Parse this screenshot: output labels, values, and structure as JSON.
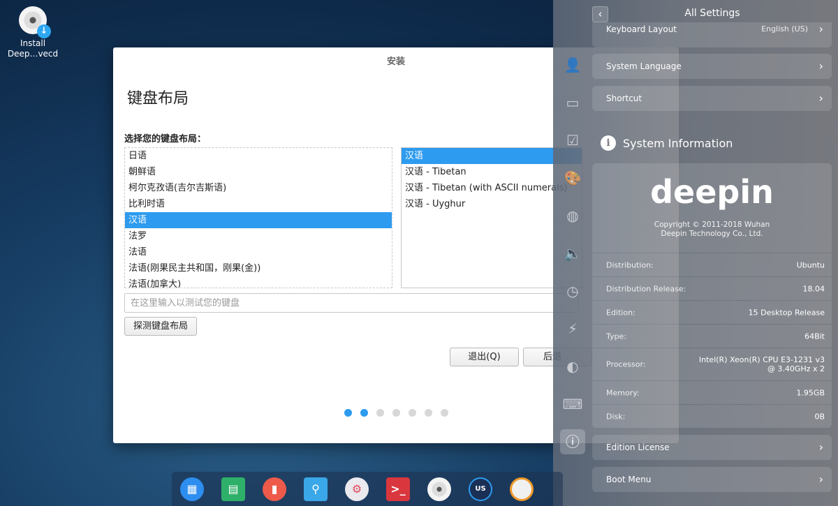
{
  "desktop": {
    "icon_label_line1": "Install",
    "icon_label_line2": "Deep…vecd"
  },
  "installer": {
    "window_title": "安装",
    "heading": "键盘布局",
    "prompt": "选择您的键盘布局：",
    "layouts": [
      "日语",
      "朝鲜语",
      "柯尔克孜语(吉尔吉斯语)",
      "比利时语",
      "汉语",
      "法罗",
      "法语",
      "法语(刚果民主共和国，刚果(金))",
      "法语(加拿大)"
    ],
    "selected_layout": "汉语",
    "variants": [
      "汉语",
      "汉语 - Tibetan",
      "汉语 - Tibetan (with ASCII numerals)",
      "汉语 - Uyghur"
    ],
    "selected_variant": "汉语",
    "test_placeholder": "在这里输入以测试您的键盘",
    "detect_button": "探测键盘布局",
    "quit_button": "退出(Q)",
    "next_button": "后退",
    "progress_steps": 7,
    "progress_completed": 2
  },
  "control_center": {
    "title": "All Settings",
    "rows": {
      "keyboard_layout": {
        "label": "Keyboard Layout",
        "value": "English (US)"
      },
      "system_language": {
        "label": "System Language"
      },
      "shortcut": {
        "label": "Shortcut"
      },
      "edition_license": {
        "label": "Edition License"
      },
      "boot_menu": {
        "label": "Boot Menu"
      }
    },
    "section_title": "System Information",
    "logo_text": "deepin",
    "copyright_line1": "Copyright © 2011-2018 Wuhan",
    "copyright_line2": "Deepin Technology Co., Ltd.",
    "info": [
      {
        "label": "Distribution:",
        "value": "Ubuntu"
      },
      {
        "label": "Distribution Release:",
        "value": "18.04"
      },
      {
        "label": "Edition:",
        "value": "15 Desktop Release"
      },
      {
        "label": "Type:",
        "value": "64Bit"
      },
      {
        "label": "Processor:",
        "value": "Intel(R) Xeon(R) CPU E3-1231 v3",
        "value2": "@ 3.40GHz x 2"
      },
      {
        "label": "Memory:",
        "value": "1.95GB"
      },
      {
        "label": "Disk:",
        "value": "0B"
      }
    ]
  },
  "dock": {
    "keyboard_indicator": "US"
  }
}
